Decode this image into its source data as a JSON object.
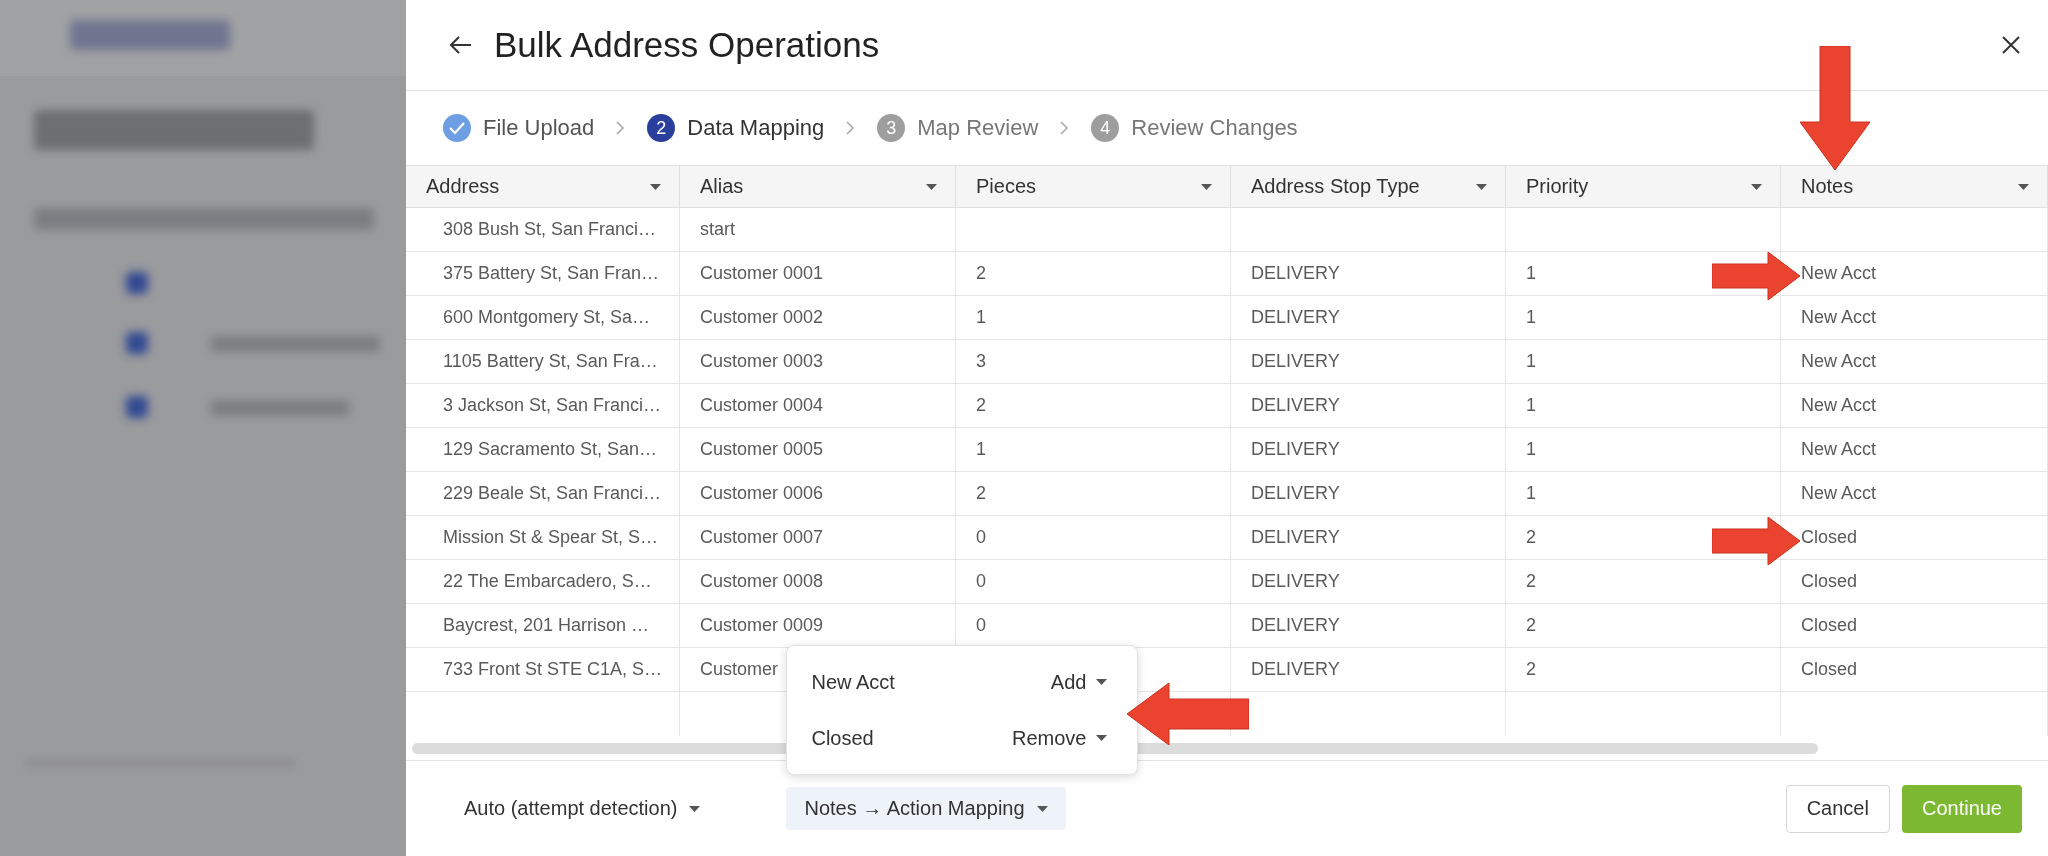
{
  "dialog": {
    "title": "Bulk Address Operations"
  },
  "steps": [
    {
      "label": "File Upload",
      "completed": true,
      "selected": false
    },
    {
      "number": "2",
      "label": "Data Mapping",
      "completed": false,
      "selected": true
    },
    {
      "number": "3",
      "label": "Map Review",
      "completed": false,
      "selected": false
    },
    {
      "number": "4",
      "label": "Review Changes",
      "completed": false,
      "selected": false
    }
  ],
  "table": {
    "columns": [
      "Address",
      "Alias",
      "Pieces",
      "Address Stop Type",
      "Priority",
      "Notes"
    ],
    "rows": [
      [
        "308 Bush St, San Franci…",
        "start",
        null,
        null,
        null,
        null
      ],
      [
        "375 Battery St, San Fran…",
        "Customer 0001",
        "2",
        "DELIVERY",
        "1",
        "New Acct"
      ],
      [
        "600 Montgomery St, Sa…",
        "Customer 0002",
        "1",
        "DELIVERY",
        "1",
        "New Acct"
      ],
      [
        "1105 Battery St, San Fra…",
        "Customer 0003",
        "3",
        "DELIVERY",
        "1",
        "New Acct"
      ],
      [
        "3 Jackson St, San Franci…",
        "Customer 0004",
        "2",
        "DELIVERY",
        "1",
        "New Acct"
      ],
      [
        "129 Sacramento St, San…",
        "Customer 0005",
        "1",
        "DELIVERY",
        "1",
        "New Acct"
      ],
      [
        "229 Beale St, San Franci…",
        "Customer 0006",
        "2",
        "DELIVERY",
        "1",
        "New Acct"
      ],
      [
        "Mission St & Spear St, S…",
        "Customer 0007",
        "0",
        "DELIVERY",
        "2",
        "Closed"
      ],
      [
        "22 The Embarcadero, S…",
        "Customer 0008",
        "0",
        "DELIVERY",
        "2",
        "Closed"
      ],
      [
        "Baycrest, 201 Harrison …",
        "Customer 0009",
        "0",
        "DELIVERY",
        "2",
        "Closed"
      ],
      [
        "733 Front St STE C1A, S…",
        "Customer",
        null,
        "DELIVERY",
        "2",
        "Closed"
      ]
    ]
  },
  "mapping_menu": {
    "items": [
      {
        "note": "New Acct",
        "action": "Add"
      },
      {
        "note": "Closed",
        "action": "Remove"
      }
    ]
  },
  "footer": {
    "detection": "Auto (attempt detection)",
    "mapping": "Notes → Action Mapping",
    "cancel": "Cancel",
    "continue": "Continue"
  }
}
